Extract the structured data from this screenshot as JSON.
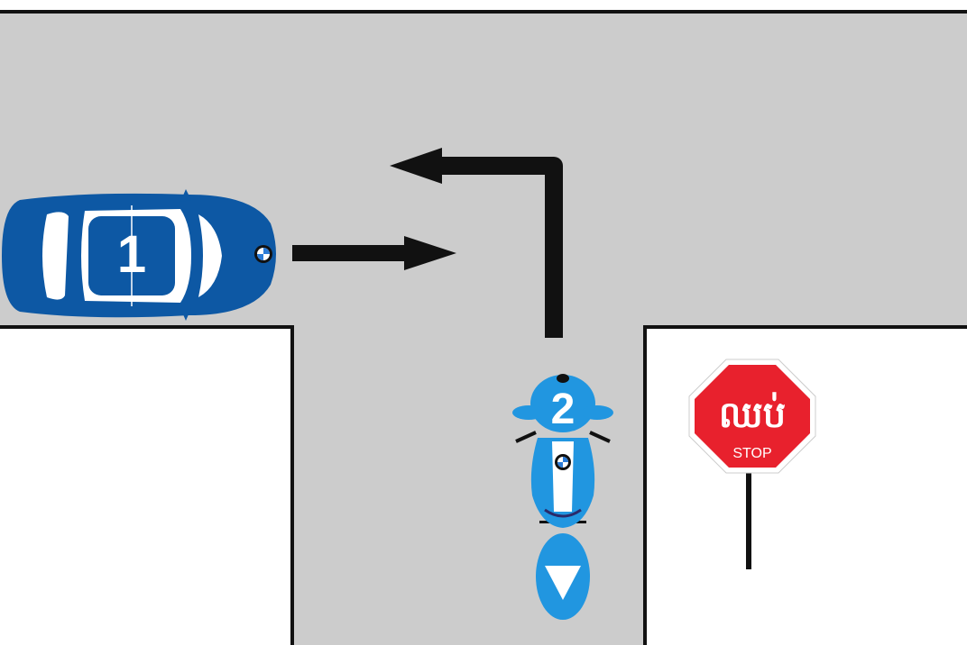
{
  "scene": {
    "colors": {
      "road": "#cccccc",
      "curb": "#111111",
      "car_blue": "#0d58a4",
      "bike_blue": "#2196e0",
      "arrow": "#111111",
      "sign_red": "#e8212d",
      "sign_text": "#ffffff"
    },
    "vehicles": [
      {
        "id": "car",
        "number": "1",
        "type": "car",
        "action": "straight"
      },
      {
        "id": "motorcycle",
        "number": "2",
        "type": "motorcycle",
        "action": "left-turn"
      }
    ],
    "sign": {
      "khmer_label": "ឈប់",
      "english_label": "STOP",
      "icon": "stop-sign-icon"
    }
  }
}
